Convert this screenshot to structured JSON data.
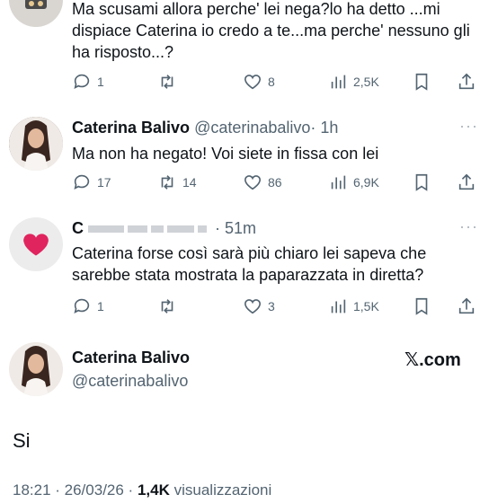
{
  "replies": [
    {
      "text": "Ma scusami allora perche' lei nega?lo ha detto ...mi dispiace Caterina io credo a te...ma perche' nessuno gli ha risposto...?",
      "counts": {
        "replies": "1",
        "retweets": "",
        "likes": "8",
        "views": "2,5K"
      }
    },
    {
      "name": "Caterina Balivo",
      "handle": "@caterinabalivo",
      "time": "· 1h",
      "text": "Ma non ha negato! Voi siete in fissa con lei",
      "counts": {
        "replies": "17",
        "retweets": "14",
        "likes": "86",
        "views": "6,9K"
      }
    },
    {
      "name": "C",
      "time": "· 51m",
      "text": "Caterina forse così sarà più chiaro lei sapeva che sarebbe stata mostrata la paparazzata in diretta?",
      "counts": {
        "replies": "1",
        "retweets": "",
        "likes": "3",
        "views": "1,5K"
      }
    }
  ],
  "more_icon": "···",
  "main_tweet": {
    "name": "Caterina Balivo",
    "handle": "@caterinabalivo",
    "source": "𝕏.com",
    "text": "Si",
    "timestamp": "18:21 · 26/03/26 ·",
    "views_count": "1,4K",
    "views_label": "visualizzazioni"
  },
  "colors": {
    "text": "#0f1419",
    "secondary": "#536471",
    "heart": "#e0245e"
  }
}
